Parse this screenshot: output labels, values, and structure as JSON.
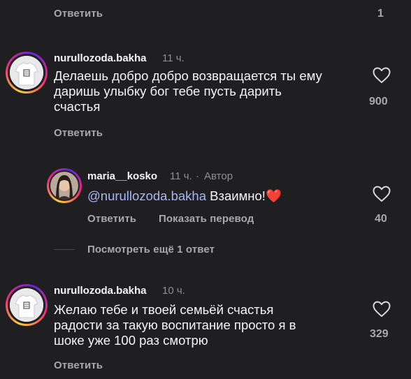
{
  "top": {
    "reply_label": "Ответить",
    "like_count": "1"
  },
  "comment1": {
    "username": "nurullozoda.bakha",
    "time": "11 ч.",
    "text_line1": "Делаешь добро добро возвращается ты ему",
    "text_line2": "даришь улыбку бог тебе пусть дарить",
    "text_line3": "счастья",
    "like_count": "900",
    "reply_label": "Ответить"
  },
  "reply1": {
    "username": "maria__kosko",
    "time": "11 ч.",
    "separator": "·",
    "author_badge": "Автор",
    "mention": "@nurullozoda.bakha",
    "text": "Взаимно!",
    "emoji": "❤️",
    "like_count": "40",
    "reply_label": "Ответить",
    "translate_label": "Показать перевод"
  },
  "more_replies": {
    "label": "Посмотреть ещё 1 ответ"
  },
  "comment2": {
    "username": "nurullozoda.bakha",
    "time": "10 ч.",
    "text_line1": "Желаю тебе и твоей семьёй счастья",
    "text_line2": "радости за такую воспитание просто я в",
    "text_line3": "шоке уже 100 раз смотрю",
    "like_count": "329",
    "reply_label": "Ответить"
  },
  "colors": {
    "background": "#1f1f22",
    "text_primary": "#f5f5f5",
    "text_secondary": "#a8a8ad",
    "mention": "#a8b7f2",
    "heart_emoji": "#e8233a"
  },
  "icons": {
    "like": "heart-outline-icon"
  }
}
